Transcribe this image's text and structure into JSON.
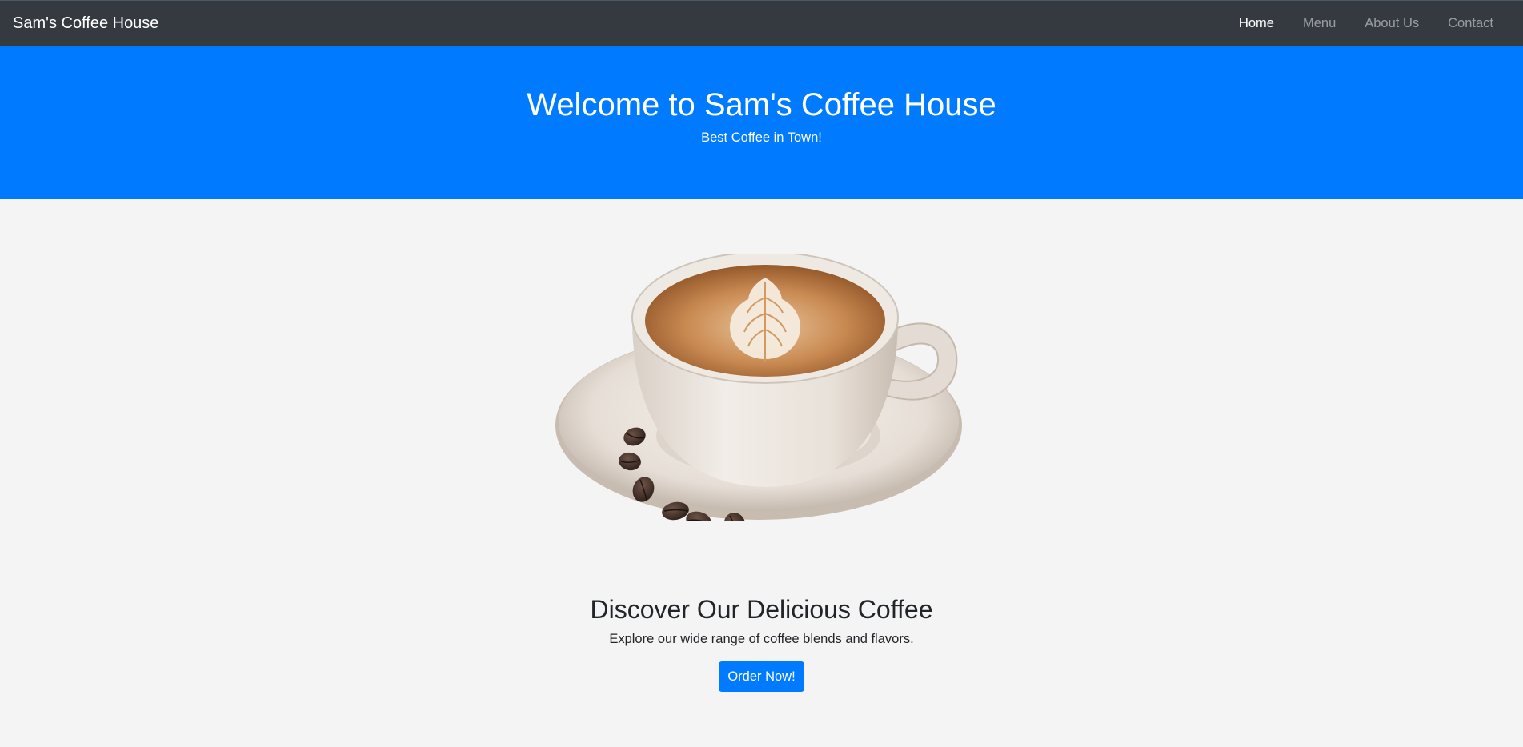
{
  "navbar": {
    "brand": "Sam's Coffee House",
    "links": [
      {
        "label": "Home",
        "active": true
      },
      {
        "label": "Menu",
        "active": false
      },
      {
        "label": "About Us",
        "active": false
      },
      {
        "label": "Contact",
        "active": false
      }
    ]
  },
  "hero": {
    "title": "Welcome to Sam's Coffee House",
    "subtitle": "Best Coffee in Town!",
    "background_color": "#007bff"
  },
  "main": {
    "image_icon": "latte-cup-with-saucer-and-beans",
    "title": "Discover Our Delicious Coffee",
    "description": "Explore our wide range of coffee blends and flavors.",
    "button_label": "Order Now!"
  },
  "colors": {
    "nav_bg": "#343a40",
    "accent": "#007bff",
    "page_bg": "#f4f4f4"
  }
}
